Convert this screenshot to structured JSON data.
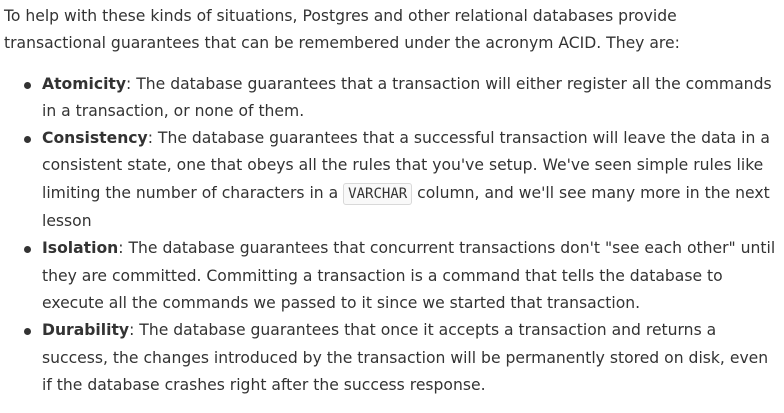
{
  "intro": "To help with these kinds of situations, Postgres and other relational databases provide transactional guarantees that can be remembered under the acronym ACID. They are:",
  "items": [
    {
      "term": "Atomicity",
      "text": ": The database guarantees that a transaction will either register all the commands in a transaction, or none of them."
    },
    {
      "term": "Consistency",
      "text_before": ": The database guarantees that a successful transaction will leave the data in a consistent state, one that obeys all the rules that you've setup. We've seen simple rules like limiting the number of characters in a ",
      "code": "VARCHAR",
      "text_after": " column, and we'll see many more in the next lesson"
    },
    {
      "term": "Isolation",
      "text": ": The database guarantees that concurrent transactions don't \"see each other\" until they are committed. Committing a transaction is a command that tells the database to execute all the commands we passed to it since we started that transaction."
    },
    {
      "term": "Durability",
      "text": ": The database guarantees that once it accepts a transaction and returns a success, the changes introduced by the transaction will be permanently stored on disk, even if the database crashes right after the success response."
    }
  ]
}
